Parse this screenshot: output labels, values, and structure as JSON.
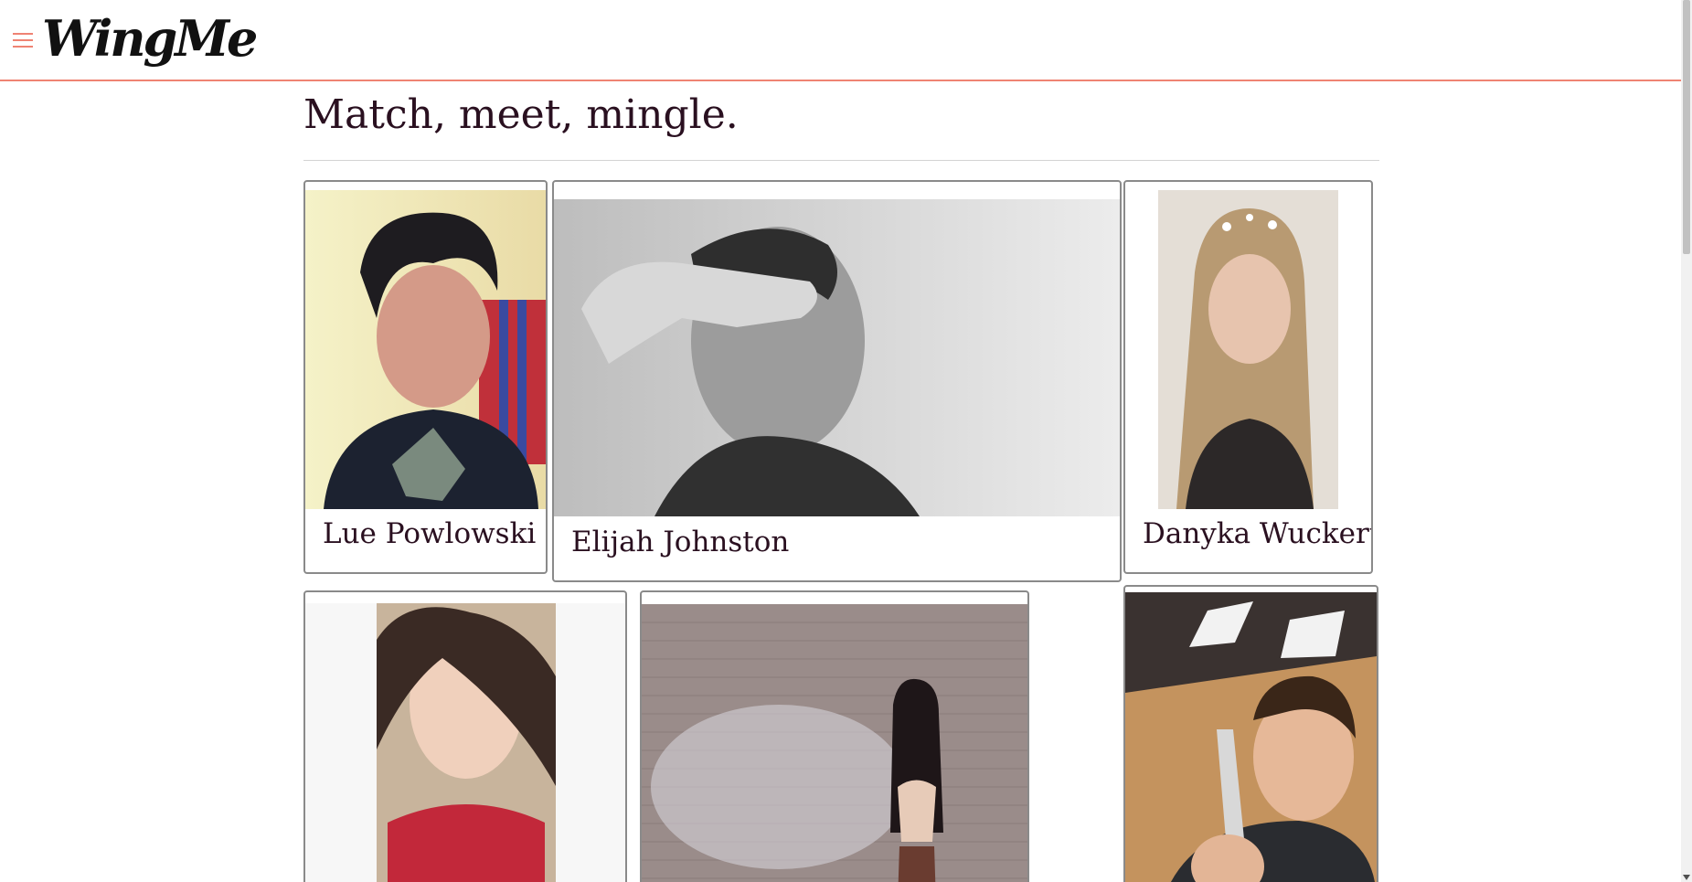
{
  "app": {
    "logo_text": "WingMe",
    "accent_color": "#ef8373",
    "menu_icon": "hamburger-menu-icon"
  },
  "main": {
    "title": "Match, meet, mingle."
  },
  "profiles": [
    {
      "name": "Lue Powlowski",
      "photo": "profile-photo"
    },
    {
      "name": "Elijah Johnston",
      "photo": "profile-photo"
    },
    {
      "name": "Danyka Wuckert V",
      "photo": "profile-photo"
    },
    {
      "name": "",
      "photo": "profile-photo"
    },
    {
      "name": "",
      "photo": "profile-photo"
    },
    {
      "name": "",
      "photo": "profile-photo"
    }
  ]
}
